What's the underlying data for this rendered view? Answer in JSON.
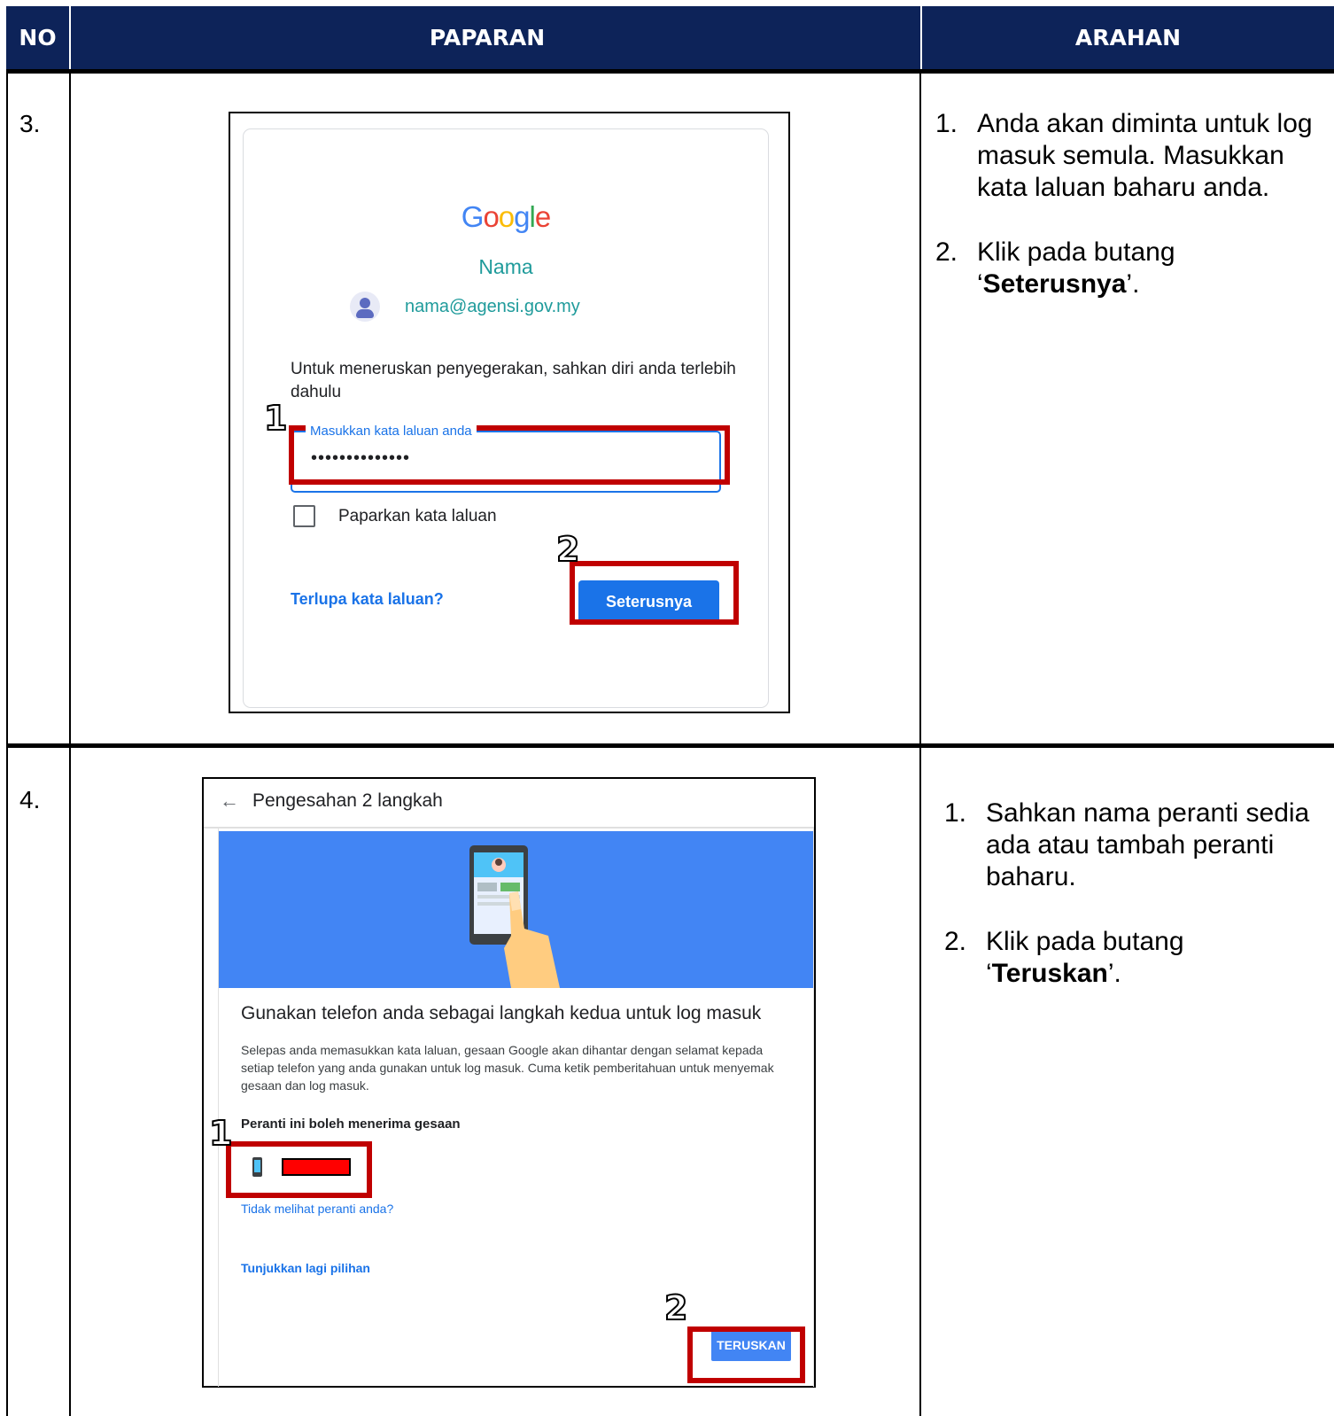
{
  "header": {
    "col_no": "NO",
    "col_display": "PAPARAN",
    "col_instruction": "ARAHAN"
  },
  "rows": [
    {
      "no": "3.",
      "screen": {
        "logo_text": "Google",
        "user_name": "Nama",
        "email": "nama@agensi.gov.my",
        "intro_text": "Untuk meneruskan penyegerakan, sahkan diri anda terlebih dahulu",
        "password_label": "Masukkan kata laluan anda",
        "password_value": "••••••••••••••",
        "show_password_label": "Paparkan kata laluan",
        "forgot_link": "Terlupa kata laluan?",
        "next_button": "Seterusnya",
        "annotation_1": "1",
        "annotation_2": "2"
      },
      "steps": [
        {
          "num": "1.",
          "text": "Anda akan diminta untuk log masuk semula. Masukkan kata laluan baharu anda."
        },
        {
          "num": "2.",
          "pre": "Klik pada butang ‘",
          "bold": "Seterusnya",
          "post": "’."
        }
      ]
    },
    {
      "no": "4.",
      "screen": {
        "title": "Pengesahan 2 langkah",
        "heading": "Gunakan telefon anda sebagai langkah kedua untuk log masuk",
        "description": "Selepas anda memasukkan kata laluan, gesaan Google akan dihantar dengan selamat kepada setiap telefon yang anda gunakan untuk log masuk. Cuma ketik pemberitahuan untuk menyemak gesaan dan log masuk.",
        "can_receive_label": "Peranti ini boleh menerima gesaan",
        "not_see_link": "Tidak melihat peranti anda?",
        "more_options_link": "Tunjukkan lagi pilihan",
        "continue_button": "TERUSKAN",
        "annotation_1": "1",
        "annotation_2": "2"
      },
      "steps": [
        {
          "num": "1.",
          "text": "Sahkan nama peranti sedia ada atau tambah peranti baharu."
        },
        {
          "num": "2.",
          "pre": "Klik pada butang ‘",
          "bold": "Teruskan",
          "post": "’."
        }
      ]
    }
  ],
  "colors": {
    "header_bg": "#0d2359",
    "annotation_red": "#c00000",
    "google_blue": "#1a73e8",
    "banner_blue": "#4285f4"
  }
}
